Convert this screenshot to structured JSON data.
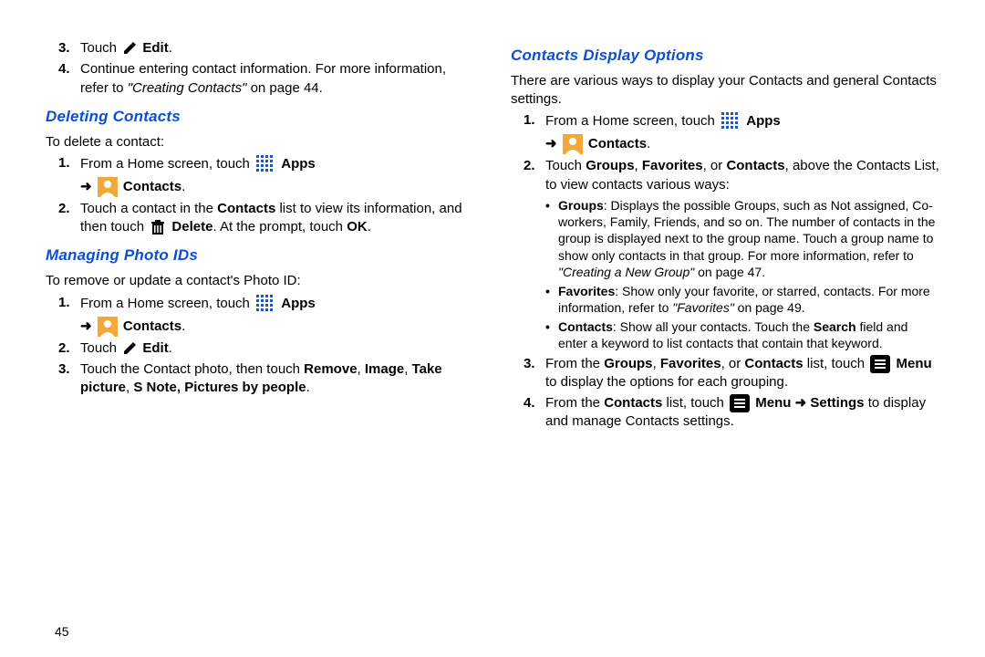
{
  "page_number": "45",
  "left": {
    "top_items": [
      {
        "n": "3.",
        "parts": [
          {
            "t": "Touch "
          },
          {
            "icon": "pencil"
          },
          {
            "t": " "
          },
          {
            "b": "Edit"
          },
          {
            "t": "."
          }
        ]
      },
      {
        "n": "4.",
        "parts": [
          {
            "t": "Continue entering contact information. For more information, refer to "
          },
          {
            "i": "\"Creating Contacts\""
          },
          {
            "t": " on page 44."
          }
        ]
      }
    ],
    "h1": "Deleting Contacts",
    "intro1": "To delete a contact:",
    "del_steps": [
      {
        "n": "1.",
        "parts": [
          {
            "t": "From a Home screen, touch "
          },
          {
            "icon": "apps"
          },
          {
            "t": " "
          },
          {
            "b": "Apps"
          }
        ]
      },
      {
        "sub": true,
        "parts": [
          {
            "arrow": "➜"
          },
          {
            "t": " "
          },
          {
            "icon": "contact"
          },
          {
            "t": " "
          },
          {
            "b": "Contacts"
          },
          {
            "t": "."
          }
        ]
      },
      {
        "n": "2.",
        "parts": [
          {
            "t": "Touch a contact in the "
          },
          {
            "b": "Contacts"
          },
          {
            "t": " list to view its information, and then touch "
          },
          {
            "icon": "trash"
          },
          {
            "t": " "
          },
          {
            "b": "Delete"
          },
          {
            "t": ". At the prompt, touch "
          },
          {
            "b": "OK"
          },
          {
            "t": "."
          }
        ]
      }
    ],
    "h2": "Managing Photo IDs",
    "intro2": "To remove or update a contact's Photo ID:",
    "photo_steps": [
      {
        "n": "1.",
        "parts": [
          {
            "t": "From a Home screen, touch "
          },
          {
            "icon": "apps"
          },
          {
            "t": " "
          },
          {
            "b": "Apps"
          }
        ]
      },
      {
        "sub": true,
        "parts": [
          {
            "arrow": "➜"
          },
          {
            "t": " "
          },
          {
            "icon": "contact"
          },
          {
            "t": " "
          },
          {
            "b": "Contacts"
          },
          {
            "t": "."
          }
        ]
      },
      {
        "n": "2.",
        "parts": [
          {
            "t": "Touch "
          },
          {
            "icon": "pencil"
          },
          {
            "t": " "
          },
          {
            "b": "Edit"
          },
          {
            "t": "."
          }
        ]
      },
      {
        "n": "3.",
        "parts": [
          {
            "t": "Touch the Contact photo, then touch "
          },
          {
            "b": "Remove"
          },
          {
            "t": ", "
          },
          {
            "b": "Image"
          },
          {
            "t": ", "
          },
          {
            "b": "Take picture"
          },
          {
            "t": ", "
          },
          {
            "b": "S Note, Pictures by people"
          },
          {
            "t": "."
          }
        ]
      }
    ]
  },
  "right": {
    "h1": "Contacts Display Options",
    "intro": "There are various ways to display your Contacts and general Contacts settings.",
    "steps": [
      {
        "n": "1.",
        "parts": [
          {
            "t": "From a Home screen, touch "
          },
          {
            "icon": "apps"
          },
          {
            "t": " "
          },
          {
            "b": "Apps"
          }
        ]
      },
      {
        "sub": true,
        "parts": [
          {
            "arrow": "➜"
          },
          {
            "t": " "
          },
          {
            "icon": "contact"
          },
          {
            "t": " "
          },
          {
            "b": "Contacts"
          },
          {
            "t": "."
          }
        ]
      },
      {
        "n": "2.",
        "parts": [
          {
            "t": "Touch "
          },
          {
            "b": "Groups"
          },
          {
            "t": ", "
          },
          {
            "b": "Favorites"
          },
          {
            "t": ", or "
          },
          {
            "b": "Contacts"
          },
          {
            "t": ", above the Contacts List, to view contacts various ways:"
          }
        ]
      }
    ],
    "bullets": [
      {
        "parts": [
          {
            "b": "Groups"
          },
          {
            "t": ": Displays the possible Groups, such as Not assigned, Co-workers, Family, Friends, and so on. The number of contacts in the group is displayed next to the group name. Touch a group name to show only contacts in that group. For more information, refer to "
          },
          {
            "i": "\"Creating a New Group\""
          },
          {
            "t": " on page 47."
          }
        ]
      },
      {
        "parts": [
          {
            "b": "Favorites"
          },
          {
            "t": ": Show only your favorite, or starred, contacts. For more information, refer to "
          },
          {
            "i": "\"Favorites\""
          },
          {
            "t": " on page 49."
          }
        ]
      },
      {
        "parts": [
          {
            "b": "Contacts"
          },
          {
            "t": ": Show all your contacts. Touch the "
          },
          {
            "b": "Search"
          },
          {
            "t": " field and enter a keyword to list contacts that contain that keyword."
          }
        ]
      }
    ],
    "steps2": [
      {
        "n": "3.",
        "parts": [
          {
            "t": "From the "
          },
          {
            "b": "Groups"
          },
          {
            "t": ", "
          },
          {
            "b": "Favorites"
          },
          {
            "t": ", or "
          },
          {
            "b": "Contacts"
          },
          {
            "t": " list, touch "
          },
          {
            "icon": "menu"
          },
          {
            "t": " "
          },
          {
            "b": "Menu"
          },
          {
            "t": " to display the options for each grouping."
          }
        ]
      },
      {
        "n": "4.",
        "parts": [
          {
            "t": "From the "
          },
          {
            "b": "Contacts"
          },
          {
            "t": " list, touch "
          },
          {
            "icon": "menu"
          },
          {
            "t": " "
          },
          {
            "b": "Menu"
          },
          {
            "t": " "
          },
          {
            "arrow": "➜"
          },
          {
            "t": " "
          },
          {
            "b": "Settings"
          },
          {
            "t": " to display and manage Contacts settings."
          }
        ]
      }
    ]
  }
}
